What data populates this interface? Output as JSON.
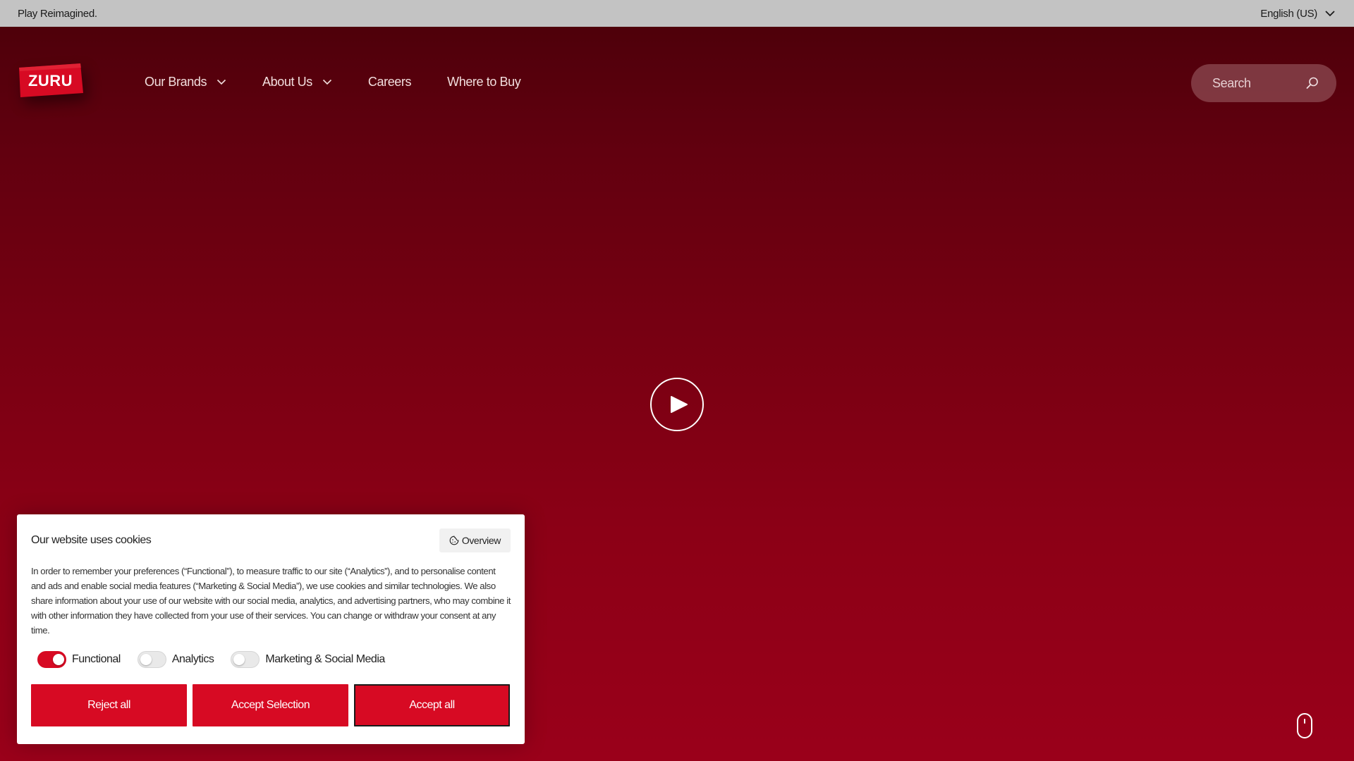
{
  "topbar": {
    "tagline": "Play Reimagined.",
    "language": "English (US)"
  },
  "header": {
    "logo_text": "ZURU",
    "nav": [
      {
        "label": "Our Brands",
        "has_dropdown": true
      },
      {
        "label": "About Us",
        "has_dropdown": true
      },
      {
        "label": "Careers",
        "has_dropdown": false
      },
      {
        "label": "Where to Buy",
        "has_dropdown": false
      }
    ],
    "search_placeholder": "Search"
  },
  "hero": {
    "play_icon": "play-icon",
    "scroll_icon": "mouse-scroll-icon"
  },
  "cookie": {
    "title": "Our website uses cookies",
    "overview_label": "Overview",
    "body": "In order to remember your preferences (“Functional”), to measure traffic to our site (“Analytics”), and to personalise content and ads and enable social media features (“Marketing & Social Media”), we use cookies and similar technologies. We also share information about your use of our website with our social media, analytics, and advertising partners, who may combine it with other information they have collected from your use of their services. You can change or withdraw your consent at any time.",
    "toggles": [
      {
        "label": "Functional",
        "on": true
      },
      {
        "label": "Analytics",
        "on": false
      },
      {
        "label": "Marketing & Social Media",
        "on": false
      }
    ],
    "buttons": {
      "reject": "Reject all",
      "accept_selection": "Accept Selection",
      "accept_all": "Accept all"
    }
  },
  "colors": {
    "brand_red": "#d70a23",
    "hero_top": "#4a0009",
    "hero_bottom": "#9a001a",
    "topbar_bg": "#c3c3c3"
  }
}
